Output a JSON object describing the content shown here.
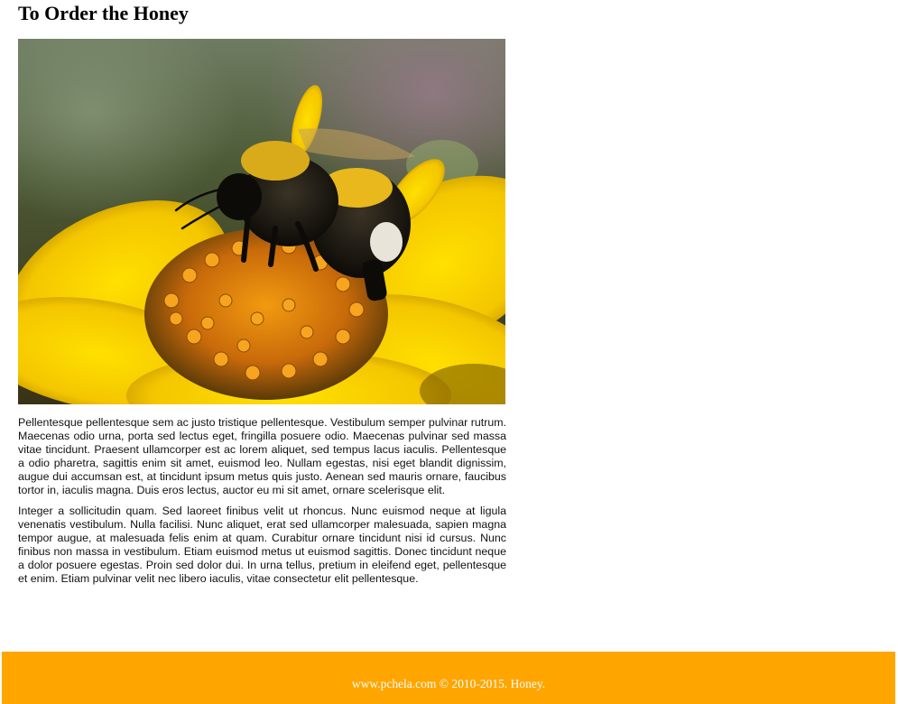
{
  "page": {
    "title": "To Order the Honey"
  },
  "hero_image": {
    "subject": "bumblebee-on-yellow-flower"
  },
  "article": {
    "paragraphs": [
      "Pellentesque pellentesque sem ac justo tristique pellentesque. Vestibulum semper pulvinar rutrum. Maecenas odio urna, porta sed lectus eget, fringilla posuere odio. Maecenas pulvinar sed massa vitae tincidunt. Praesent ullamcorper est ac lorem aliquet, sed tempus lacus iaculis. Pellentesque a odio pharetra, sagittis enim sit amet, euismod leo. Nullam egestas, nisi eget blandit dignissim, augue dui accumsan est, at tincidunt ipsum metus quis justo. Aenean sed mauris ornare, faucibus tortor in, iaculis magna. Duis eros lectus, auctor eu mi sit amet, ornare scelerisque elit.",
      "Integer a sollicitudin quam. Sed laoreet finibus velit ut rhoncus. Nunc euismod neque at ligula venenatis vestibulum. Nulla facilisi. Nunc aliquet, erat sed ullamcorper malesuada, sapien magna tempor augue, at malesuada felis enim at quam. Curabitur ornare tincidunt nisi id cursus. Nunc finibus non massa in vestibulum. Etiam euismod metus ut euismod sagittis. Donec tincidunt neque a dolor posuere egestas. Proin sed dolor dui. In urna tellus, pretium in eleifend eget, pellentesque et enim. Etiam pulvinar velit nec libero iaculis, vitae consectetur elit pellentesque."
    ]
  },
  "footer": {
    "text": "www.pchela.com © 2010-2015. Honey."
  },
  "colors": {
    "footer_background": "#FFA500",
    "footer_text": "#ffffff",
    "flower_yellow": "#F2C300"
  }
}
